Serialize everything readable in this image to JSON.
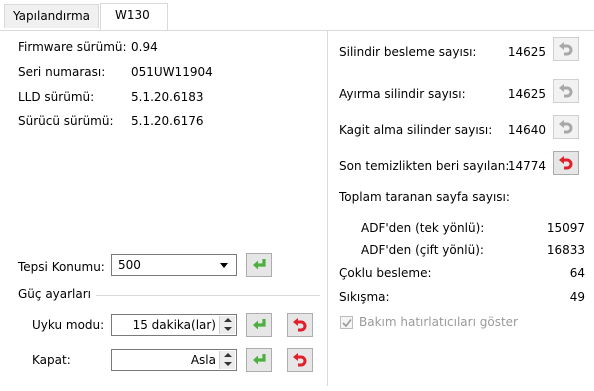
{
  "tabs": [
    {
      "label": "Yapılandırma"
    },
    {
      "label": "W130"
    }
  ],
  "info": {
    "firmware": {
      "label": "Firmware sürümü:",
      "value": "0.94"
    },
    "serial": {
      "label": "Seri numarası:",
      "value": "051UW11904"
    },
    "lld": {
      "label": "LLD sürümü:",
      "value": "5.1.20.6183"
    },
    "driver": {
      "label": "Sürücü sürümü:",
      "value": "5.1.20.6176"
    }
  },
  "tray": {
    "label": "Tepsi Konumu:",
    "value": "500"
  },
  "power": {
    "title": "Güç ayarları",
    "sleep": {
      "label": "Uyku modu:",
      "value": "15 dakika(lar)"
    },
    "off": {
      "label": "Kapat:",
      "value": "Asla"
    }
  },
  "counters": [
    {
      "label": "Silindir besleme sayısı:",
      "value": "14625"
    },
    {
      "label": "Ayırma silindir sayısı:",
      "value": "14625"
    },
    {
      "label": "Kagit alma silinder sayısı:",
      "value": "14640"
    },
    {
      "label": "Son temizlikten beri sayılan:",
      "value": "14774"
    }
  ],
  "totals": {
    "title": "Toplam taranan sayfa sayısı:",
    "simplex": {
      "label": "ADF'den (tek yönlü):",
      "value": "15097"
    },
    "duplex": {
      "label": "ADF'den (çift yönlü):",
      "value": "16833"
    },
    "multifeed": {
      "label": "Çoklu besleme:",
      "value": "64"
    },
    "jam": {
      "label": "Sıkışma:",
      "value": "49"
    }
  },
  "maintenance": {
    "label": "Bakım hatırlatıcıları göster",
    "checked": true,
    "enabled": false
  },
  "colors": {
    "apply_green": "#4caf3f",
    "reset_red": "#e0202a",
    "disabled_gray": "#a8a8a8"
  }
}
